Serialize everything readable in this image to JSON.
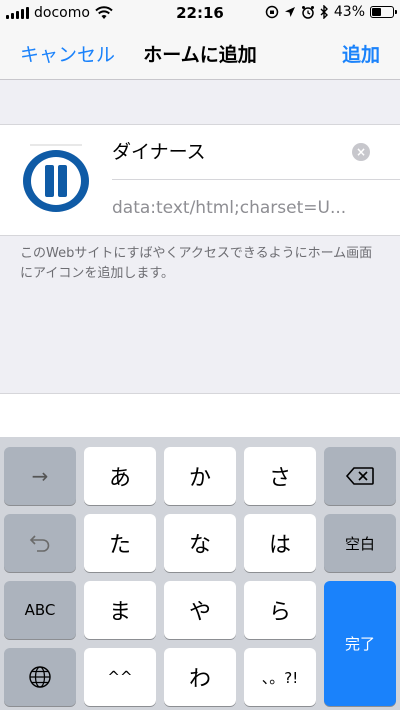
{
  "status": {
    "carrier": "docomo",
    "time": "22:16",
    "battery": "43%",
    "battery_level": 0.43
  },
  "nav": {
    "cancel": "キャンセル",
    "title": "ホームに追加",
    "add": "追加"
  },
  "bookmark": {
    "name": "ダイナース",
    "url": "data:text/html;charset=U...",
    "clear_glyph": "×"
  },
  "description": "このWebサイトにすばやくアクセスできるようにホーム画面にアイコンを追加します。",
  "keyboard": {
    "row1": [
      "あ",
      "か",
      "さ"
    ],
    "row2": [
      "た",
      "な",
      "は"
    ],
    "row3": [
      "ま",
      "や",
      "ら"
    ],
    "row4": [
      "^^",
      "わ",
      "、。?!"
    ],
    "arrow_glyph": "→",
    "space_label": "空白",
    "abc_label": "ABC",
    "done_label": "完了"
  },
  "colors": {
    "accent": "#1a82fb",
    "keyboard_bg": "#d1d4da",
    "fn_key": "#acb3bd"
  }
}
